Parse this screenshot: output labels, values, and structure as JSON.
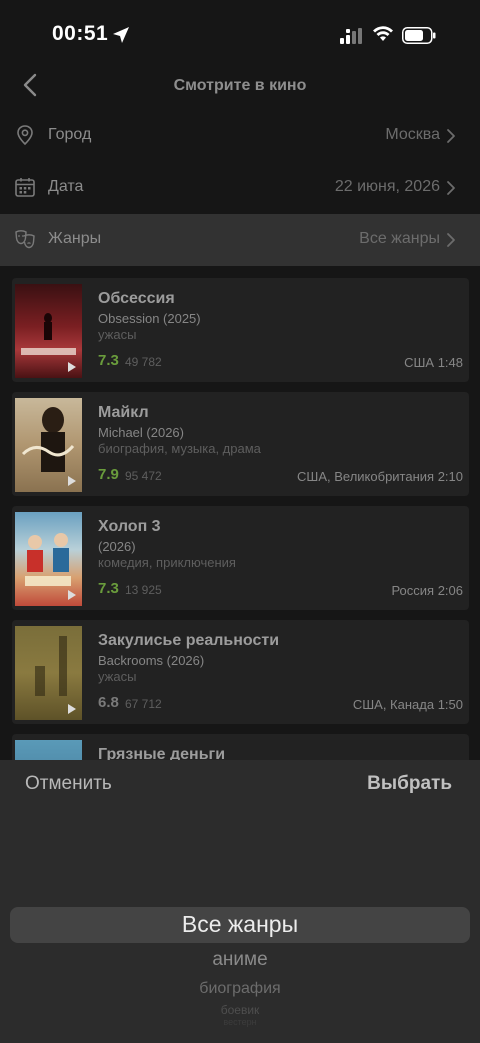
{
  "status_bar": {
    "time": "00:51"
  },
  "nav": {
    "title": "Смотрите в кино"
  },
  "filters": [
    {
      "label": "Город",
      "value": "Москва"
    },
    {
      "label": "Дата",
      "value": "22 июня, 2026"
    },
    {
      "label": "Жанры",
      "value": "Все жанры"
    }
  ],
  "movies": [
    {
      "title": "Обсессия",
      "original": "Obsession (2025)",
      "genres": "ужасы",
      "rating": "7.3",
      "votes": "49 782",
      "meta": "США 1:48",
      "rating_color": "#6a9c3c"
    },
    {
      "title": "Майкл",
      "original": "Michael (2026)",
      "genres": "биография, музыка, драма",
      "rating": "7.9",
      "votes": "95 472",
      "meta": "США, Великобритания 2:10",
      "rating_color": "#6a9c3c"
    },
    {
      "title": "Холоп 3",
      "original": "(2026)",
      "genres": "комедия, приключения",
      "rating": "7.3",
      "votes": "13 925",
      "meta": "Россия 2:06",
      "rating_color": "#6a9c3c"
    },
    {
      "title": "Закулисье реальности",
      "original": "Backrooms (2026)",
      "genres": "ужасы",
      "rating": "6.8",
      "votes": "67 712",
      "meta": "США, Канада 1:50",
      "rating_color": "#7a7a7a"
    },
    {
      "title": "Грязные деньги",
      "original": "",
      "genres": "",
      "rating": "",
      "votes": "",
      "meta": "",
      "rating_color": "#6a9c3c"
    }
  ],
  "sheet": {
    "cancel_label": "Отменить",
    "confirm_label": "Выбрать",
    "picker_items": [
      "Все жанры",
      "аниме",
      "биография",
      "боевик",
      "вестерн"
    ]
  }
}
